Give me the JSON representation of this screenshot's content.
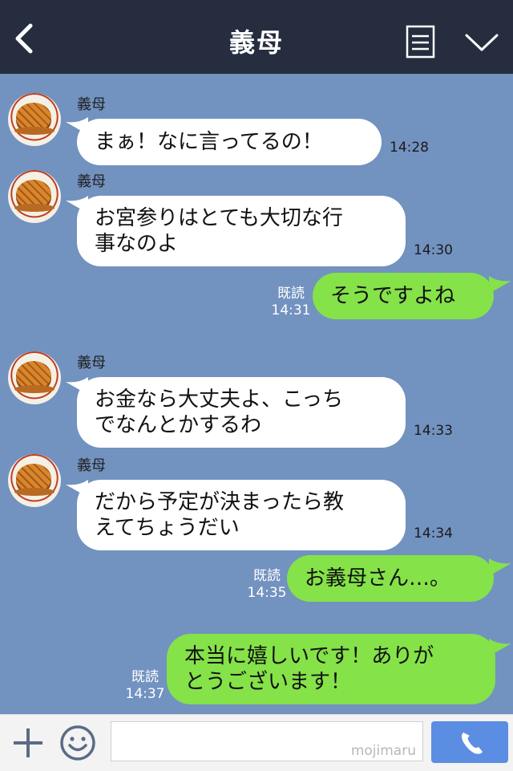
{
  "header": {
    "title": "義母"
  },
  "icons": {
    "back": "chevron-left-icon",
    "memo": "memo-icon",
    "menu": "chevron-down-icon",
    "plus": "plus-icon",
    "emoji": "smiley-icon",
    "call": "phone-icon"
  },
  "messages": [
    {
      "side": "in",
      "sender": "義母",
      "text": "まぁ！なに言ってるの！",
      "time": "14:28"
    },
    {
      "side": "in",
      "sender": "義母",
      "text": "お宮参りはとても大切な行\n事なのよ",
      "time": "14:30"
    },
    {
      "side": "out",
      "read_label": "既読",
      "text": "そうですよね",
      "time": "14:31"
    },
    {
      "side": "in",
      "sender": "義母",
      "text": "お金なら大丈夫よ、こっち\nでなんとかするわ",
      "time": "14:33"
    },
    {
      "side": "in",
      "sender": "義母",
      "text": "だから予定が決まったら教\nえてちょうだい",
      "time": "14:34"
    },
    {
      "side": "out",
      "read_label": "既読",
      "text": "お義母さん…。",
      "time": "14:35"
    },
    {
      "side": "out",
      "read_label": "既読",
      "text": "本当に嬉しいです！ありが\nとうございます！",
      "time": "14:37"
    }
  ],
  "footer": {
    "input_value": "",
    "watermark": "mojimaru"
  },
  "colors": {
    "header_bg": "#252d3f",
    "chat_bg": "#7292c0",
    "incoming_bubble": "#ffffff",
    "outgoing_bubble": "#85e249",
    "call_button": "#5b8de3"
  }
}
